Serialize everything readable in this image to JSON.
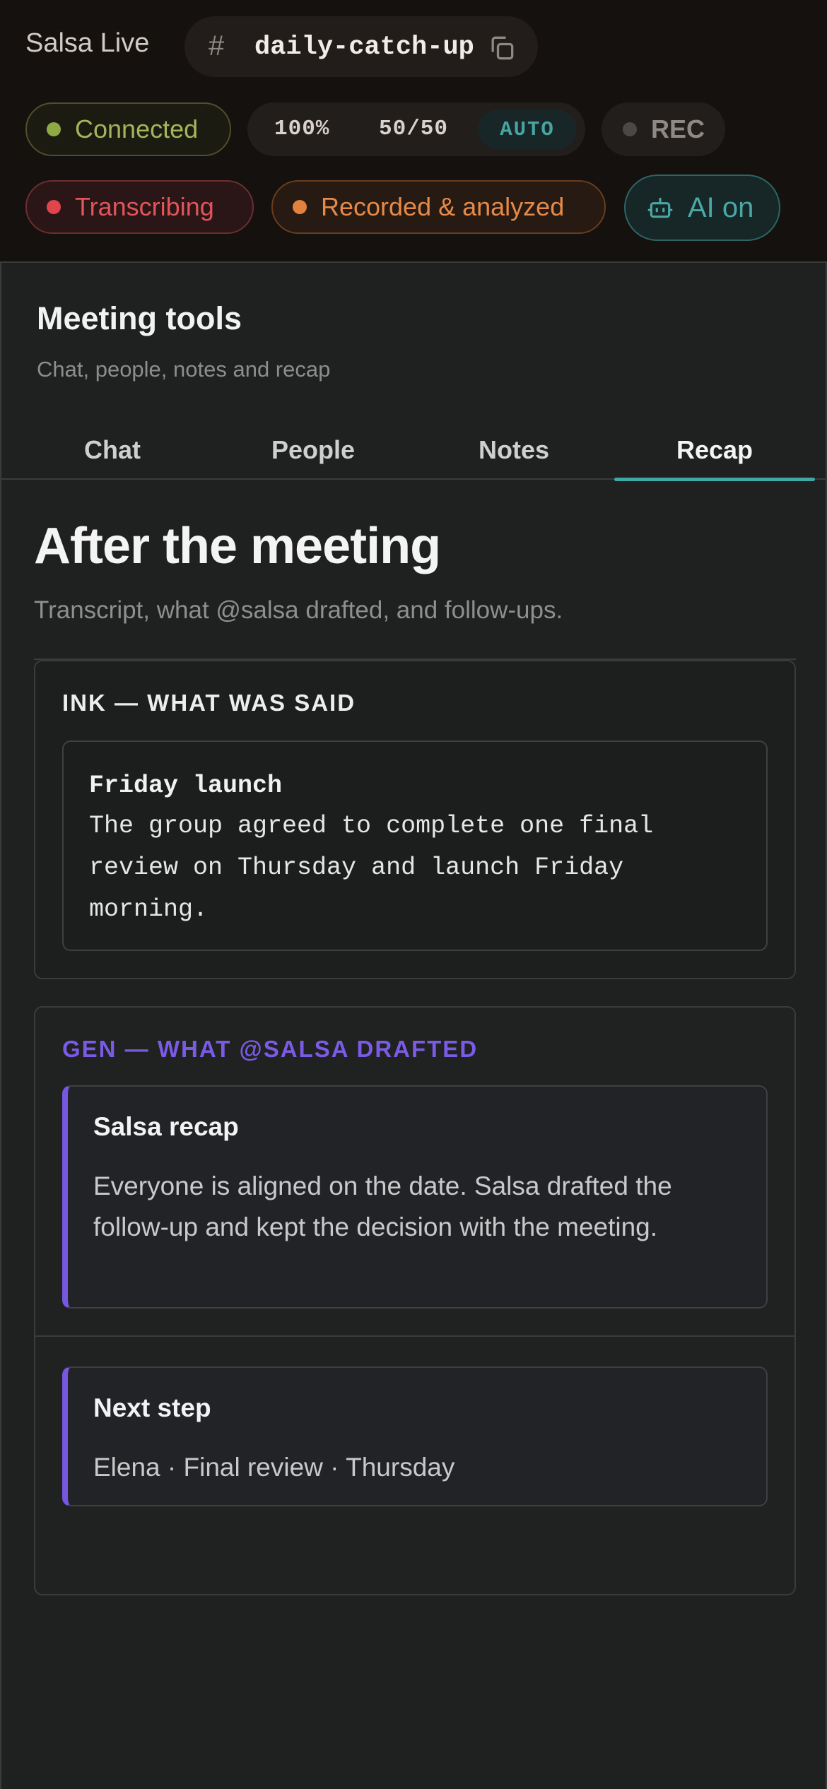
{
  "header": {
    "app_name": "Salsa Live",
    "channel_hash": "#",
    "channel_name": "daily-catch-up",
    "status": {
      "connected": "Connected",
      "meter_level": "100%",
      "meter_split": "50/50",
      "meter_mode": "AUTO",
      "rec": "REC",
      "transcribing": "Transcribing",
      "recorded": "Recorded & analyzed",
      "ai": "AI on"
    }
  },
  "panel": {
    "title": "Meeting tools",
    "subtitle": "Chat, people, notes and recap",
    "tabs": [
      "Chat",
      "People",
      "Notes",
      "Recap"
    ],
    "active_tab": "Recap"
  },
  "recap": {
    "heading": "After the meeting",
    "subheading": "Transcript, what @salsa drafted, and follow-ups.",
    "ink": {
      "label": "INK — WHAT WAS SAID",
      "title": "Friday launch",
      "text": "The group agreed to complete one final review on Thursday and launch Friday morning."
    },
    "gen": {
      "label": "GEN — WHAT @SALSA DRAFTED",
      "recap_title": "Salsa recap",
      "recap_text": "Everyone is aligned on the date. Salsa drafted the follow-up and kept the decision with the meeting.",
      "next_title": "Next step",
      "next_text": "Elena · Final review · Thursday"
    }
  },
  "colors": {
    "accent_teal": "#41a8a6",
    "gen_purple": "#7657e0",
    "connected_green": "#a3b65a",
    "transcribing_red": "#e0555a",
    "recorded_orange": "#e58a48"
  },
  "icons": [
    "hash-icon",
    "copy-icon",
    "robot-icon"
  ]
}
